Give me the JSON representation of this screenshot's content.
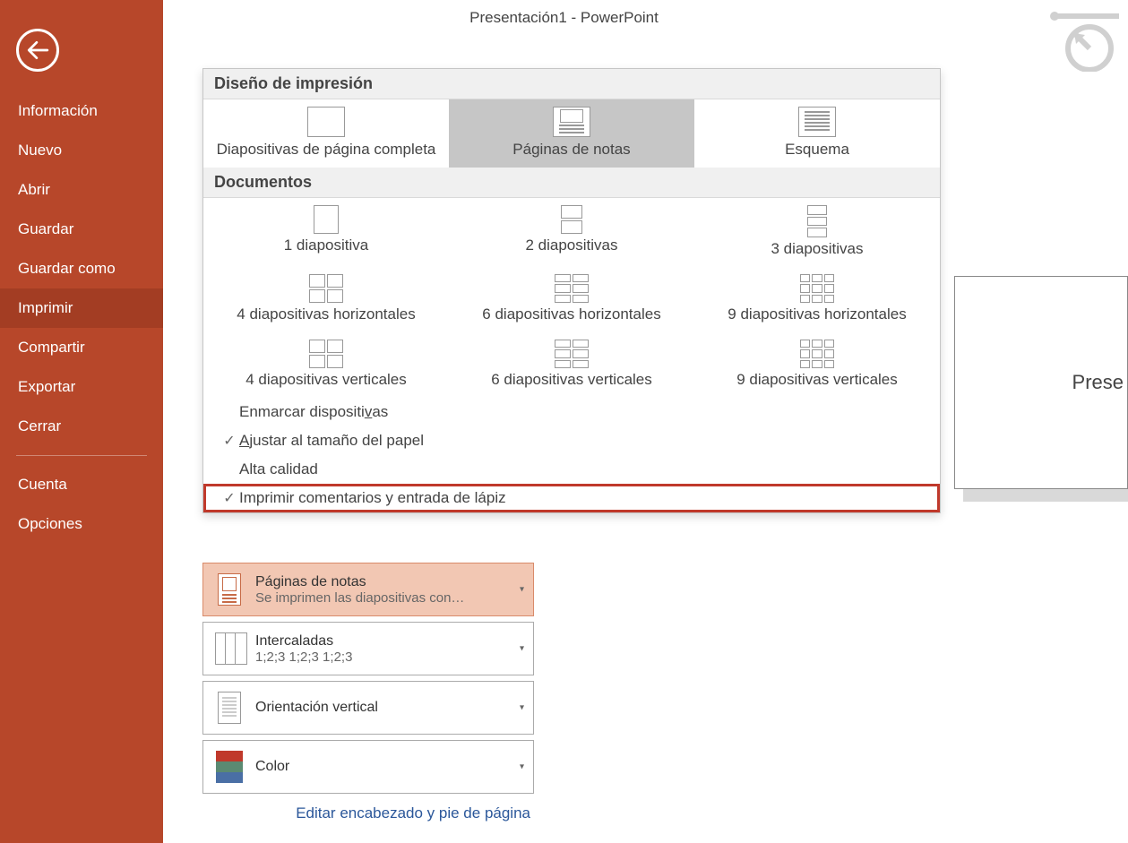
{
  "app_title": "Presentación1 - PowerPoint",
  "sidebar": {
    "items": [
      {
        "label": "Información"
      },
      {
        "label": "Nuevo"
      },
      {
        "label": "Abrir"
      },
      {
        "label": "Guardar"
      },
      {
        "label": "Guardar como"
      },
      {
        "label": "Imprimir"
      },
      {
        "label": "Compartir"
      },
      {
        "label": "Exportar"
      },
      {
        "label": "Cerrar"
      }
    ],
    "footer": [
      {
        "label": "Cuenta"
      },
      {
        "label": "Opciones"
      }
    ]
  },
  "panel": {
    "section_layout": "Diseño de impresión",
    "layouts": [
      {
        "label": "Diapositivas de página completa"
      },
      {
        "label": "Páginas de notas"
      },
      {
        "label": "Esquema"
      }
    ],
    "section_docs": "Documentos",
    "docs": [
      {
        "label": "1 diapositiva"
      },
      {
        "label": "2 diapositivas"
      },
      {
        "label": "3 diapositivas"
      },
      {
        "label": "4 diapositivas horizontales"
      },
      {
        "label": "6 diapositivas horizontales"
      },
      {
        "label": "9 diapositivas horizontales"
      },
      {
        "label": "4 diapositivas verticales"
      },
      {
        "label": "6 diapositivas verticales"
      },
      {
        "label": "9 diapositivas verticales"
      }
    ],
    "options": [
      {
        "checked": false,
        "pre": "Enmarcar dispositi",
        "key": "v",
        "post": "as"
      },
      {
        "checked": true,
        "pre": "",
        "key": "A",
        "post": "justar al tamaño del papel"
      },
      {
        "checked": false,
        "pre": "Alta calidad",
        "key": "",
        "post": ""
      },
      {
        "checked": true,
        "pre": "Imprimir comentarios y entrada de lápiz",
        "key": "",
        "post": ""
      }
    ]
  },
  "settings": {
    "layout": {
      "title": "Páginas de notas",
      "sub": "Se imprimen las diapositivas con…"
    },
    "collate": {
      "title": "Intercaladas",
      "sub": "1;2;3     1;2;3     1;2;3"
    },
    "orient": {
      "title": "Orientación vertical"
    },
    "color": {
      "title": "Color"
    },
    "edit_link": "Editar encabezado y pie de página"
  },
  "preview_text": "Prese",
  "check_glyph": "✓",
  "caret_glyph": "▾"
}
